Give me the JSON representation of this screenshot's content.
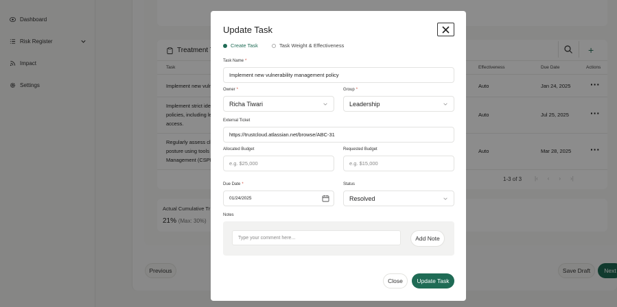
{
  "sidebar": {
    "items": [
      {
        "label": "Dashboard",
        "icon": "eye-icon"
      },
      {
        "label": "Risk Register",
        "icon": "list-icon"
      },
      {
        "label": "Impact",
        "icon": "rss-icon"
      },
      {
        "label": "Settings",
        "icon": "gear-icon"
      }
    ]
  },
  "treatment": {
    "title": "Treatment Ta",
    "columns": {
      "task": "Task",
      "effectiveness": "Effectiveness",
      "due_date": "Due Date",
      "actions": "Actions"
    },
    "rows": [
      {
        "task_lines": [
          "Implement new vuln"
        ],
        "effectiveness": "Auto",
        "due": "Jan 24, 2025"
      },
      {
        "task_lines": [
          "Implement strict ide",
          "policies, including le",
          "access."
        ],
        "effectiveness": "Auto",
        "due": "Jul 25, 2025"
      },
      {
        "task_lines": [
          "Regularly assess clo",
          "posture using tools",
          "Management (CSPM"
        ],
        "effectiveness": "Auto",
        "due": "Mar 28, 2025"
      }
    ],
    "pagination": "1-3 of 3"
  },
  "cumulative": {
    "label": "Actual Cumulative Tr",
    "value": "21%",
    "max": "(Max: 30%)"
  },
  "footer": {
    "previous": "Previous",
    "save_draft": "Save Draft",
    "next": "Next"
  },
  "modal": {
    "title": "Update Task",
    "steps": [
      {
        "label": "Create Task",
        "active": true
      },
      {
        "label": "Task Weight & Effectiveness",
        "active": false
      }
    ],
    "task_name": {
      "label": "Task Name",
      "value": "Implement new vulnerability management policy"
    },
    "owner": {
      "label": "Owner",
      "value": "Richa Tiwari"
    },
    "group": {
      "label": "Group",
      "value": "Leadership"
    },
    "external_ticket": {
      "label": "External Ticket",
      "value": "https://trustcloud.atlassian.net/browse/ABC-31"
    },
    "allocated_budget": {
      "label": "Allocated Budget",
      "placeholder": "e.g. $25,000"
    },
    "requested_budget": {
      "label": "Requested Budget",
      "placeholder": "e.g. $15,000"
    },
    "due_date": {
      "label": "Due Date",
      "value": "01/24/2025"
    },
    "status": {
      "label": "Status",
      "value": "Resolved"
    },
    "notes": {
      "label": "Notes",
      "placeholder": "Type your comment here...",
      "add_label": "Add Note"
    },
    "close_label": "Close",
    "update_label": "Update Task"
  },
  "colors": {
    "accent": "#1f6b55",
    "required": "#d14a3a"
  }
}
